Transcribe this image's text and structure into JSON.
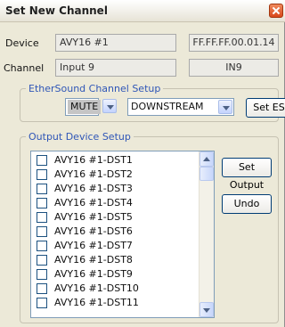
{
  "window": {
    "title": "Set New Channel"
  },
  "device": {
    "label": "Device",
    "name": "AVY16 #1",
    "address": "FF.FF.FF.00.01.14"
  },
  "channel": {
    "label": "Channel",
    "name": "Input 9",
    "code": "IN9"
  },
  "ethersound": {
    "group_title": "EtherSound Channel Setup",
    "mode_value": "MUTE",
    "direction_value": "DOWNSTREAM",
    "set_es_label": "Set ES"
  },
  "output": {
    "group_title": "Output Device Setup",
    "items": [
      "AVY16 #1-DST1",
      "AVY16 #1-DST2",
      "AVY16 #1-DST3",
      "AVY16 #1-DST4",
      "AVY16 #1-DST5",
      "AVY16 #1-DST6",
      "AVY16 #1-DST7",
      "AVY16 #1-DST8",
      "AVY16 #1-DST9",
      "AVY16 #1-DST10",
      "AVY16 #1-DST11"
    ],
    "set_output_label": "Set Output",
    "undo_label": "Undo"
  }
}
